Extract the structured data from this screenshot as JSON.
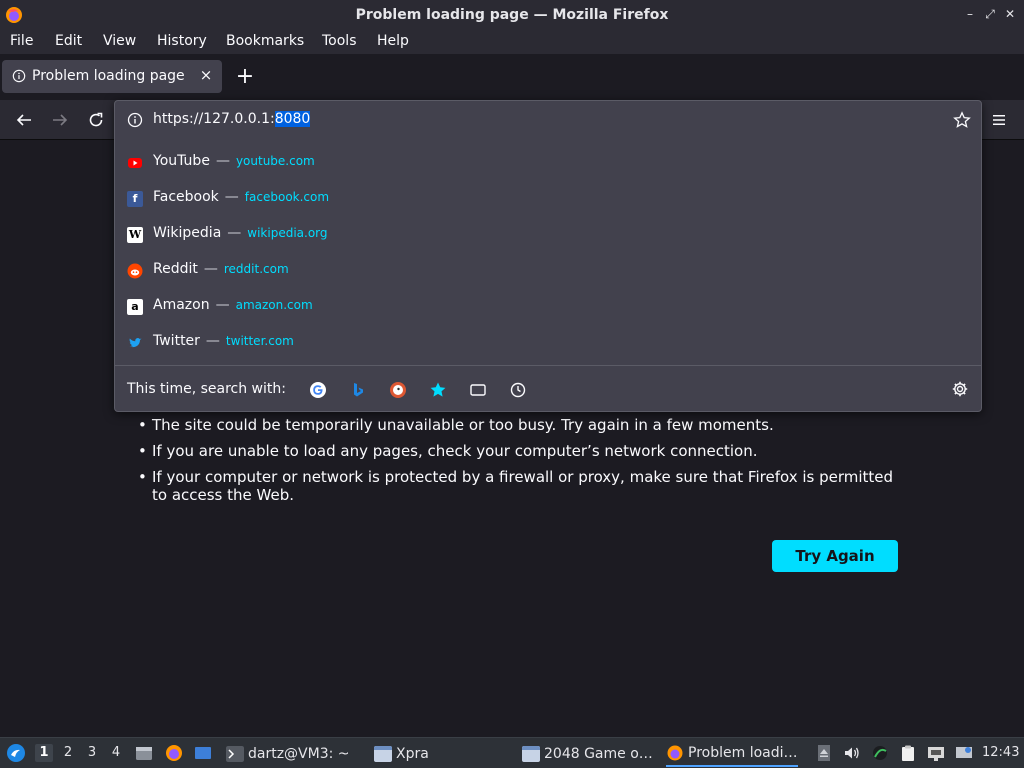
{
  "window": {
    "title": "Problem loading page — Mozilla Firefox"
  },
  "menu": {
    "file": "File",
    "edit": "Edit",
    "view": "View",
    "history": "History",
    "bookmarks": "Bookmarks",
    "tools": "Tools",
    "help": "Help"
  },
  "tab": {
    "label": "Problem loading page",
    "close": "×"
  },
  "urlbar": {
    "url_prefix": "https://127.0.0.1:",
    "url_selected": "8080"
  },
  "results": [
    {
      "name": "YouTube",
      "site": "youtube.com",
      "icon": "youtube-icon",
      "color": "#ff0000"
    },
    {
      "name": "Facebook",
      "site": "facebook.com",
      "icon": "facebook-icon",
      "color": "#3b5998"
    },
    {
      "name": "Wikipedia",
      "site": "wikipedia.org",
      "icon": "wikipedia-icon",
      "color": "#ffffff"
    },
    {
      "name": "Reddit",
      "site": "reddit.com",
      "icon": "reddit-icon",
      "color": "#ff4500"
    },
    {
      "name": "Amazon",
      "site": "amazon.com",
      "icon": "amazon-icon",
      "color": "#ffffff"
    },
    {
      "name": "Twitter",
      "site": "twitter.com",
      "icon": "twitter-icon",
      "color": "#1da1f2"
    }
  ],
  "search_with": {
    "label": "This time, search with:"
  },
  "page": {
    "bullets": [
      "The site could be temporarily unavailable or too busy. Try again in a few moments.",
      "If you are unable to load any pages, check your computer’s network connection.",
      "If your computer or network is protected by a firewall or proxy, make sure that Firefox is permitted to access the Web."
    ],
    "try_again": "Try Again"
  },
  "taskbar": {
    "workspaces": [
      "1",
      "2",
      "3",
      "4"
    ],
    "tasks": [
      "dartz@VM3: ~",
      "Xpra",
      "2048 Game o…",
      "Problem loadi…"
    ],
    "clock": "12:43"
  },
  "colors": {
    "accent": "#00ddff",
    "selection": "#0061e0",
    "panel": "#42414d",
    "background": "#1c1b22"
  }
}
